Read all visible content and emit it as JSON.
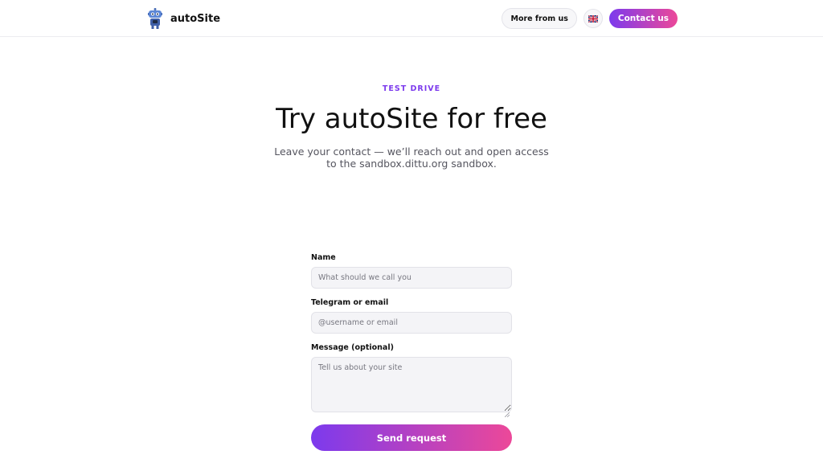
{
  "header": {
    "brand": "autoSite",
    "logo_icon": "robot-icon",
    "more_label": "More from us",
    "language_icon": "uk-flag-icon",
    "contact_label": "Contact us"
  },
  "hero": {
    "eyebrow": "TEST DRIVE",
    "title": "Try autoSite for free",
    "subtitle": "Leave your contact — we’ll reach out and open access to the sandbox.dittu.org sandbox."
  },
  "form": {
    "name_label": "Name",
    "name_placeholder": "What should we call you",
    "name_value": "",
    "contact_label": "Telegram or email",
    "contact_placeholder": "@username or email",
    "contact_value": "",
    "message_label": "Message (optional)",
    "message_placeholder": "Tell us about your site",
    "message_value": "",
    "submit_label": "Send request"
  },
  "colors": {
    "accent": "#7c3aed",
    "accent_end": "#ec4899",
    "field_bg": "#f4f4f7"
  }
}
